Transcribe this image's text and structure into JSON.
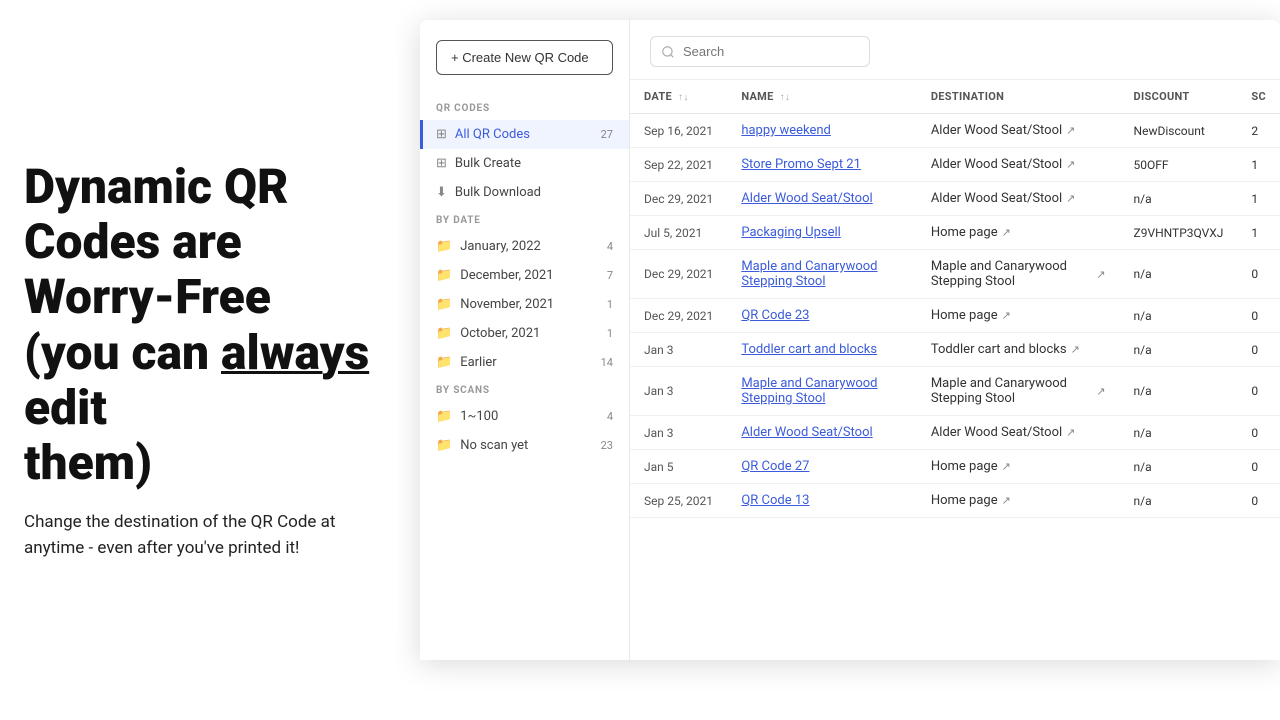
{
  "marketing": {
    "headline_part1": "Dynamic QR",
    "headline_part2": "Codes are",
    "headline_part3": "Worry-Free",
    "headline_part4_pre": "(you can",
    "headline_highlight": "always",
    "headline_part4_post": "edit",
    "headline_part5": "them)",
    "subtext": "Change the destination of the QR Code at anytime - even after you've printed it!"
  },
  "sidebar": {
    "create_button": "+ Create New QR Code",
    "qr_codes_section": "QR CODES",
    "items": [
      {
        "label": "All QR Codes",
        "badge": "27",
        "active": true,
        "icon": "list"
      },
      {
        "label": "Bulk Create",
        "badge": "",
        "active": false,
        "icon": "grid"
      },
      {
        "label": "Bulk Download",
        "badge": "",
        "active": false,
        "icon": "download"
      }
    ],
    "by_date_section": "BY DATE",
    "date_items": [
      {
        "label": "January, 2022",
        "badge": "4"
      },
      {
        "label": "December, 2021",
        "badge": "7"
      },
      {
        "label": "November, 2021",
        "badge": "1"
      },
      {
        "label": "October, 2021",
        "badge": "1"
      },
      {
        "label": "Earlier",
        "badge": "14"
      }
    ],
    "by_scans_section": "BY SCANS",
    "scans_items": [
      {
        "label": "1~100",
        "badge": "4"
      },
      {
        "label": "No scan yet",
        "badge": "23"
      }
    ]
  },
  "search": {
    "placeholder": "Search"
  },
  "table": {
    "columns": [
      {
        "key": "date",
        "label": "DATE",
        "sortable": true
      },
      {
        "key": "name",
        "label": "NAME",
        "sortable": true
      },
      {
        "key": "destination",
        "label": "DESTINATION",
        "sortable": false
      },
      {
        "key": "discount",
        "label": "DISCOUNT",
        "sortable": false
      },
      {
        "key": "scans",
        "label": "SC",
        "sortable": false
      }
    ],
    "rows": [
      {
        "date": "Sep 16, 2021",
        "name": "happy weekend",
        "destination": "Alder Wood Seat/Stool",
        "discount": "NewDiscount",
        "scans": "2"
      },
      {
        "date": "Sep 22, 2021",
        "name": "Store Promo Sept 21",
        "destination": "Alder Wood Seat/Stool",
        "discount": "50OFF",
        "scans": "1"
      },
      {
        "date": "Dec 29, 2021",
        "name": "Alder Wood Seat/Stool",
        "destination": "Alder Wood Seat/Stool",
        "discount": "n/a",
        "scans": "1"
      },
      {
        "date": "Jul 5, 2021",
        "name": "Packaging Upsell",
        "destination": "Home page",
        "discount": "Z9VHNTP3QVXJ",
        "scans": "1"
      },
      {
        "date": "Dec 29, 2021",
        "name": "Maple and Canarywood Stepping Stool",
        "destination": "Maple and Canarywood Stepping Stool",
        "discount": "n/a",
        "scans": "0"
      },
      {
        "date": "Dec 29, 2021",
        "name": "QR Code 23",
        "destination": "Home page",
        "discount": "n/a",
        "scans": "0"
      },
      {
        "date": "Jan 3",
        "name": "Toddler cart and blocks",
        "destination": "Toddler cart and blocks",
        "discount": "n/a",
        "scans": "0"
      },
      {
        "date": "Jan 3",
        "name": "Maple and Canarywood Stepping Stool",
        "destination": "Maple and Canarywood Stepping Stool",
        "discount": "n/a",
        "scans": "0"
      },
      {
        "date": "Jan 3",
        "name": "Alder Wood Seat/Stool",
        "destination": "Alder Wood Seat/Stool",
        "discount": "n/a",
        "scans": "0"
      },
      {
        "date": "Jan 5",
        "name": "QR Code 27",
        "destination": "Home page",
        "discount": "n/a",
        "scans": "0"
      },
      {
        "date": "Sep 25, 2021",
        "name": "QR Code 13",
        "destination": "Home page",
        "discount": "n/a",
        "scans": "0"
      }
    ]
  }
}
